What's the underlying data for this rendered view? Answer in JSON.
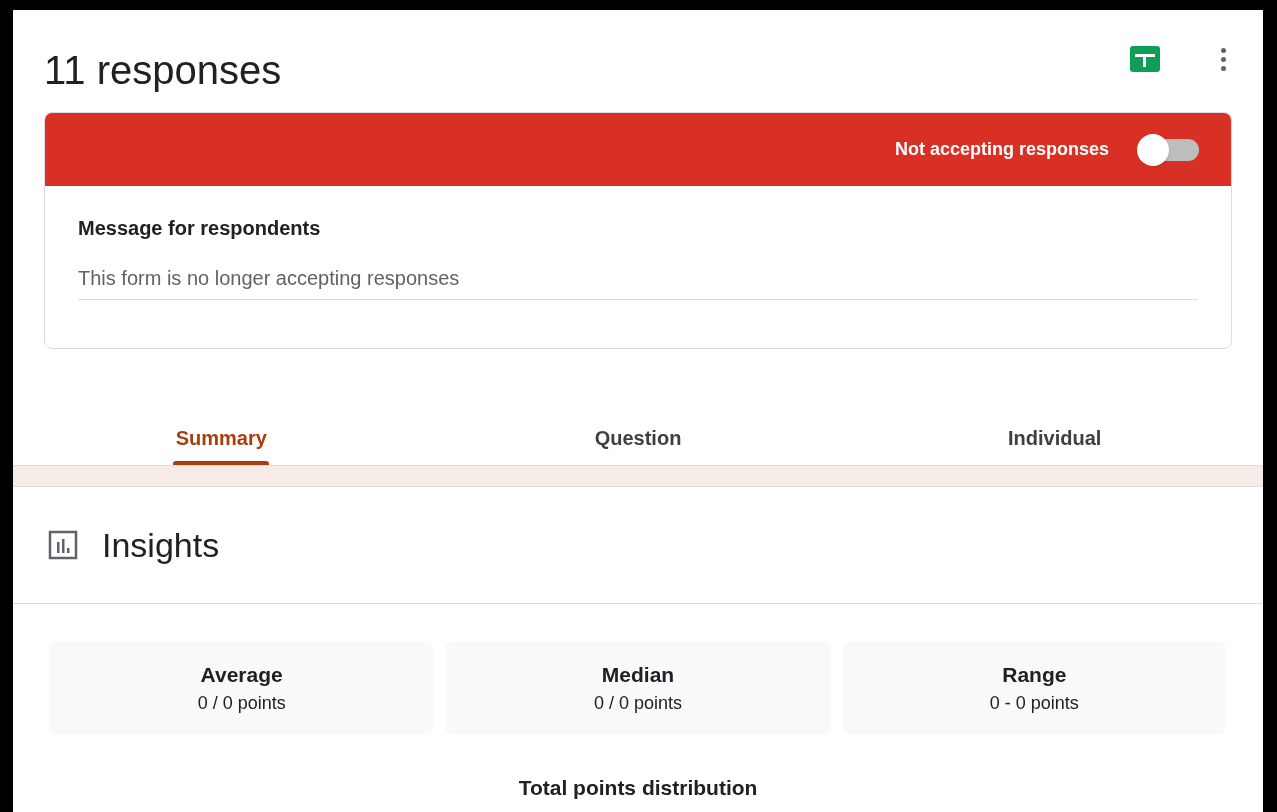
{
  "header": {
    "title": "11 responses"
  },
  "banner": {
    "label": "Not accepting responses",
    "accepting": false
  },
  "message": {
    "label": "Message for respondents",
    "value": "This form is no longer accepting responses"
  },
  "tabs": [
    {
      "label": "Summary",
      "selected": true
    },
    {
      "label": "Question",
      "selected": false
    },
    {
      "label": "Individual",
      "selected": false
    }
  ],
  "insights": {
    "title": "Insights"
  },
  "stats": [
    {
      "label": "Average",
      "value": "0 / 0 points"
    },
    {
      "label": "Median",
      "value": "0 / 0 points"
    },
    {
      "label": "Range",
      "value": "0 - 0 points"
    }
  ],
  "distribution": {
    "title": "Total points distribution"
  }
}
